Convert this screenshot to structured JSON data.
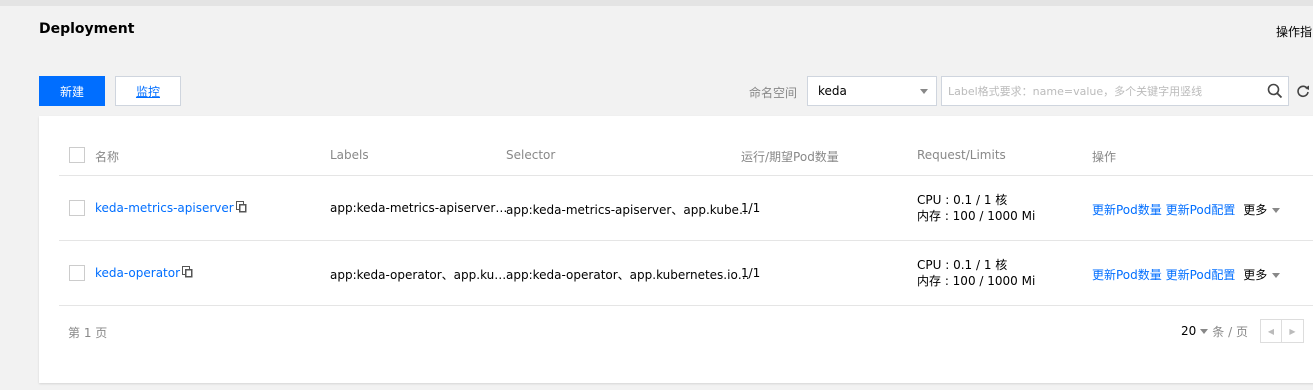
{
  "page": {
    "title": "Deployment",
    "guide_link": "操作指",
    "new_button": "新建",
    "monitor_button": "监控"
  },
  "filter": {
    "namespace_label": "命名空间",
    "namespace_value": "keda",
    "search_placeholder": "Label格式要求：name=value，多个关键字用竖线"
  },
  "table": {
    "columns": [
      "名称",
      "Labels",
      "Selector",
      "运行/期望Pod数量",
      "Request/Limits",
      "操作"
    ],
    "rows": [
      {
        "name": "keda-metrics-apiserver",
        "labels": "app:keda-metrics-apiserver…",
        "selector": "app:keda-metrics-apiserver、app.kube…",
        "pods": "1/1",
        "cpu": "CPU : 0.1 / 1 核",
        "mem": "内存 : 100 / 1000 Mi",
        "actions": [
          "更新Pod数量",
          "更新Pod配置",
          "更多"
        ]
      },
      {
        "name": "keda-operator",
        "labels": "app:keda-operator、app.ku…",
        "selector": "app:keda-operator、app.kubernetes.io…",
        "pods": "1/1",
        "cpu": "CPU : 0.1 / 1 核",
        "mem": "内存 : 100 / 1000 Mi",
        "actions": [
          "更新Pod数量",
          "更新Pod配置",
          "更多"
        ]
      }
    ]
  },
  "pagination": {
    "page_info": "第 1 页",
    "page_size": "20",
    "per_page_suffix": "条 / 页",
    "prev": "◀",
    "next": "▶"
  },
  "colors": {
    "accent": "#006eff",
    "background": "#f2f2f2"
  },
  "icons": [
    "search-icon",
    "refresh-icon",
    "copy-icon",
    "chevron-down-icon"
  ]
}
